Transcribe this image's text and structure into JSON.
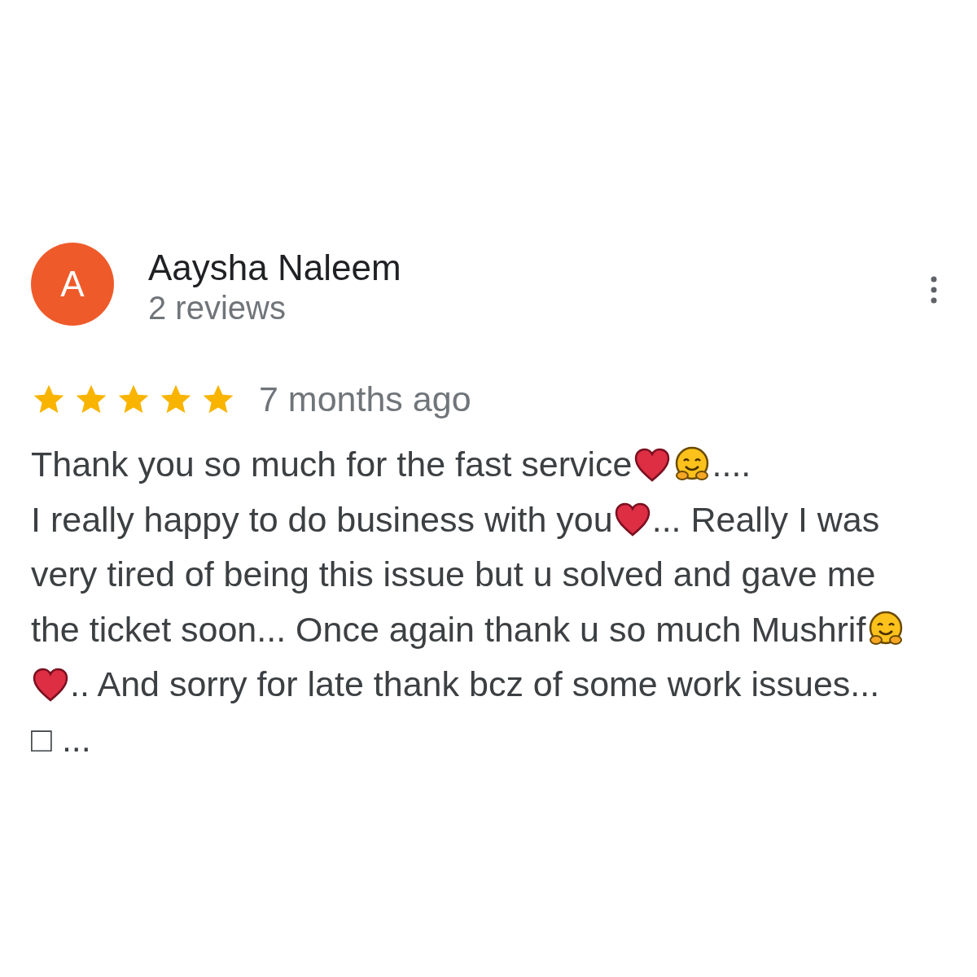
{
  "reviewer": {
    "initial": "A",
    "name": "Aaysha Naleem",
    "reviews": "2 reviews"
  },
  "review": {
    "stars": 5,
    "time": "7 months ago",
    "lines": [
      [
        {
          "kind": "text",
          "text": "Thank you so much for the fast service"
        },
        {
          "kind": "heart"
        },
        {
          "kind": "hug"
        },
        {
          "kind": "text",
          "text": "...."
        }
      ],
      [
        {
          "kind": "text",
          "text": "I really happy to do business with you"
        },
        {
          "kind": "heart"
        },
        {
          "kind": "text",
          "text": "... Really I was"
        }
      ],
      [
        {
          "kind": "text",
          "text": "very tired of being this issue but u solved and gave me"
        }
      ],
      [
        {
          "kind": "text",
          "text": "the ticket soon... Once again thank u so much Mushrif"
        },
        {
          "kind": "hug"
        }
      ],
      [
        {
          "kind": "heart"
        },
        {
          "kind": "text",
          "text": ".. And sorry for late thank bcz of some work issues..."
        }
      ],
      [
        {
          "kind": "text",
          "text": "□ ..."
        }
      ]
    ]
  }
}
